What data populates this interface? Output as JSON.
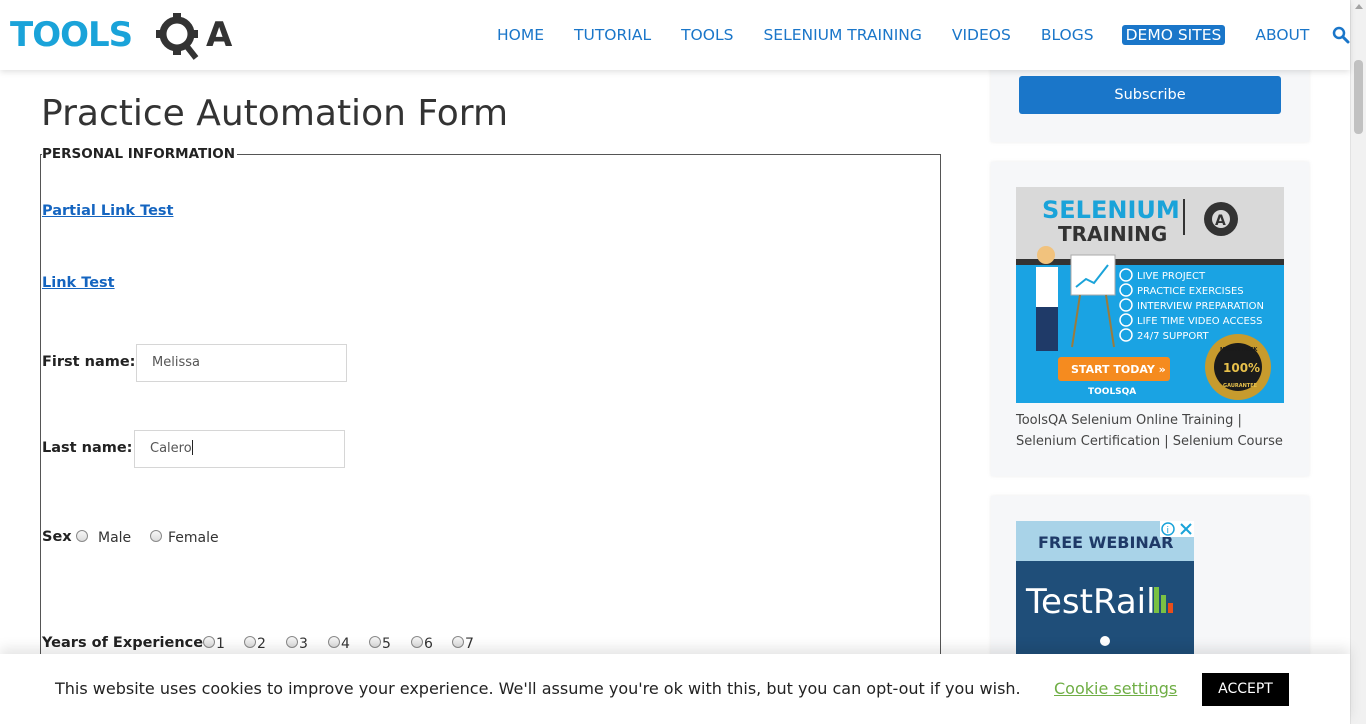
{
  "header": {
    "logo": {
      "text_left": "TOOLS",
      "text_right": "QA",
      "brand_color": "#1aa3d9",
      "dark_color": "#333333"
    },
    "nav": [
      {
        "label": "HOME"
      },
      {
        "label": "TUTORIAL"
      },
      {
        "label": "TOOLS"
      },
      {
        "label": "SELENIUM TRAINING"
      },
      {
        "label": "VIDEOS"
      },
      {
        "label": "BLOGS"
      },
      {
        "label": "DEMO SITES",
        "active": true
      },
      {
        "label": "ABOUT"
      }
    ],
    "search_icon": "search-icon",
    "accent": "#1a76c9"
  },
  "main": {
    "title": "Practice Automation Form",
    "legend": "PERSONAL INFORMATION",
    "partial_link": "Partial Link Test",
    "link_test": "Link Test",
    "first_name": {
      "label": "First name:",
      "value": "Melissa"
    },
    "last_name": {
      "label": "Last name:",
      "value": "Calero"
    },
    "sex": {
      "label": "Sex",
      "options": [
        "Male",
        "Female"
      ]
    },
    "experience": {
      "label": "Years of Experience",
      "options": [
        "1",
        "2",
        "3",
        "4",
        "5",
        "6",
        "7"
      ]
    }
  },
  "sidebar": {
    "subscribe_label": "Subscribe",
    "training_ad": {
      "heading1": "SELENIUM",
      "heading2": "TRAINING",
      "bullets": [
        "LIVE PROJECT",
        "PRACTICE EXERCISES",
        "INTERVIEW PREPARATION",
        "LIFE TIME VIDEO ACCESS",
        "24/7 SUPPORT"
      ],
      "cta": "START TODAY »",
      "brand": "TOOLSQA",
      "badge": "100%",
      "badge_top": "MONEY BACK",
      "badge_bottom": "GAURANTEE"
    },
    "caption_line1": "ToolsQA Selenium Online Training |",
    "caption_line2": "Selenium Certification | Selenium Course",
    "webinar_ad": {
      "heading": "FREE WEBINAR",
      "product": "TestRail"
    }
  },
  "cookie": {
    "text": "This website uses cookies to improve your experience. We'll assume you're ok with this, but you can opt-out if you wish.",
    "settings_label": "Cookie settings",
    "accept_label": "ACCEPT",
    "settings_color": "#6fae45"
  }
}
